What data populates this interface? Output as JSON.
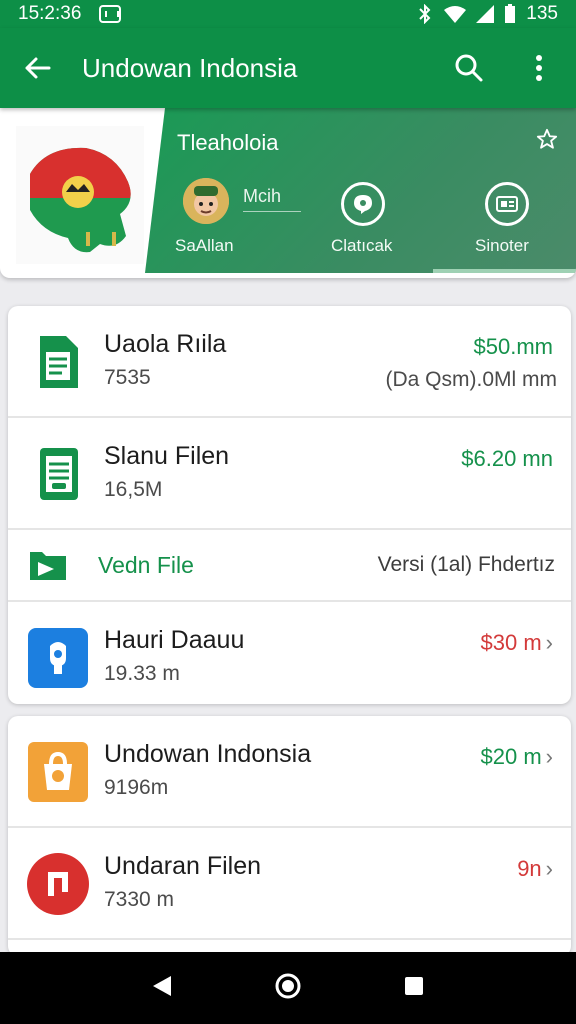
{
  "status": {
    "time": "15:2:36",
    "battery": "135"
  },
  "app_bar": {
    "title": "Undowan Indonsia"
  },
  "profile": {
    "name": "Tleaholoia",
    "muted_name": "Mcih",
    "stats": [
      {
        "label": "SaAllan"
      },
      {
        "label": "Clatıcak"
      },
      {
        "label": "Sinoter"
      }
    ]
  },
  "files": [
    {
      "name": "Uaola Rıila",
      "sub": "7535",
      "price": "$50.mm",
      "right_sub": "(Da Qsm).0Ml mm",
      "icon": "document-icon"
    },
    {
      "name": "Slanu Filen",
      "sub": "16,5M",
      "price": "$6.20 mn",
      "icon": "document-icon"
    },
    {
      "name": "Vedn File",
      "right": "Versi (1al) Fhdertız",
      "icon": "folder-icon"
    },
    {
      "name": "Hauri Daauu",
      "sub": "19.33 m",
      "price": "$30 m",
      "icon": "app-blue-icon"
    }
  ],
  "apps": [
    {
      "name": "Undowan Indonsia",
      "sub": "9196m",
      "price": "$20 m",
      "icon": "bag-orange-icon"
    },
    {
      "name": "Undaran Filen",
      "sub": "7330 m",
      "price": "9n",
      "icon": "app-red-icon"
    }
  ],
  "colors": {
    "primary": "#0d8f47",
    "accent_red": "#d33a3a"
  }
}
